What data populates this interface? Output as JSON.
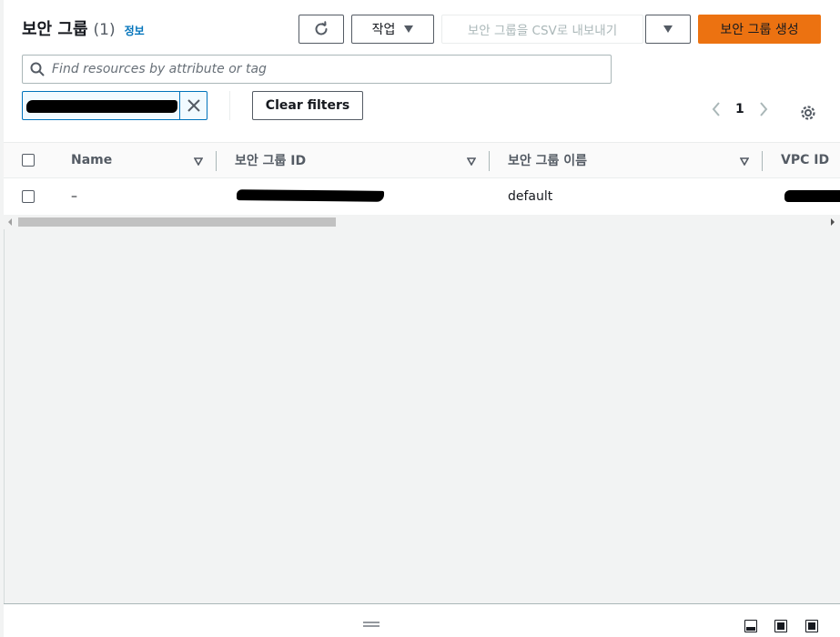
{
  "header": {
    "title": "보안 그룹",
    "count": "(1)",
    "info_link": "정보"
  },
  "toolbar": {
    "refresh_icon": "refresh-icon",
    "actions_label": "작업",
    "export_label": "보안 그룹을 CSV로 내보내기",
    "create_label": "보안 그룹 생성"
  },
  "search": {
    "placeholder": "Find resources by attribute or tag"
  },
  "filter": {
    "clear_label": "Clear filters"
  },
  "pagination": {
    "current_page": "1"
  },
  "table": {
    "columns": [
      "Name",
      "보안 그룹 ID",
      "보안 그룹 이름",
      "VPC ID"
    ],
    "rows": [
      {
        "name": "–",
        "group_name": "default"
      }
    ]
  },
  "colors": {
    "primary_button": "#ec7211",
    "link": "#0073bb",
    "token_border": "#0073bb"
  }
}
